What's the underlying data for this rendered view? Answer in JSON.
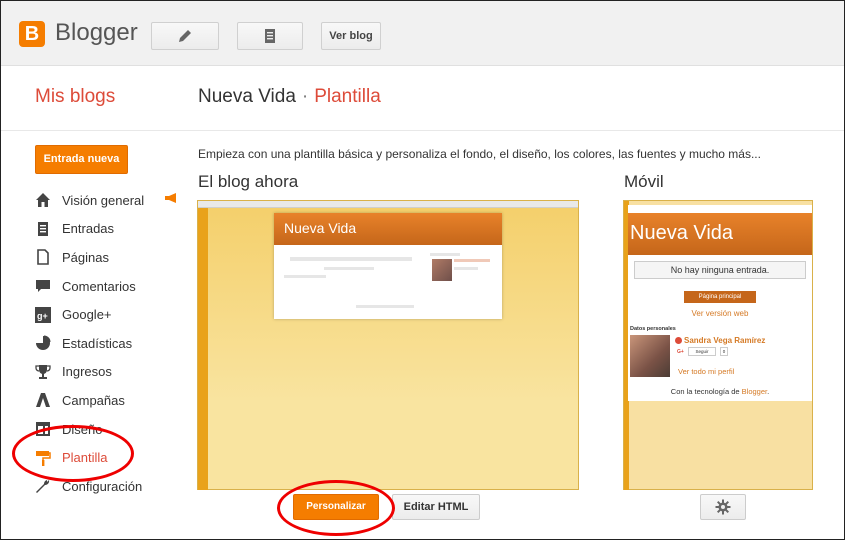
{
  "app": {
    "logo_letter": "B",
    "logo_text": "Blogger",
    "view_blog_label": "Ver blog"
  },
  "header": {
    "my_blogs": "Mis blogs",
    "blog_name": "Nueva Vida",
    "separator": "·",
    "current_page": "Plantilla"
  },
  "sidebar": {
    "new_post_label": "Entrada nueva",
    "items": [
      {
        "label": "Visión general",
        "icon": "home-icon"
      },
      {
        "label": "Entradas",
        "icon": "posts-icon"
      },
      {
        "label": "Páginas",
        "icon": "pages-icon"
      },
      {
        "label": "Comentarios",
        "icon": "comments-icon"
      },
      {
        "label": "Google+",
        "icon": "google-plus-icon"
      },
      {
        "label": "Estadísticas",
        "icon": "stats-icon"
      },
      {
        "label": "Ingresos",
        "icon": "trophy-icon"
      },
      {
        "label": "Campañas",
        "icon": "campaigns-icon"
      },
      {
        "label": "Diseño",
        "icon": "layout-icon"
      },
      {
        "label": "Plantilla",
        "icon": "paint-roller-icon",
        "active": true
      },
      {
        "label": "Configuración",
        "icon": "wrench-icon"
      }
    ]
  },
  "main": {
    "intro": "Empieza con una plantilla básica y personaliza el fondo, el diseño, los colores, las fuentes y mucho más...",
    "current_label": "El blog ahora",
    "mobile_label": "Móvil",
    "desktop_preview": {
      "title": "Nueva Vida"
    },
    "mobile_preview": {
      "title": "Nueva Vida",
      "no_posts": "No hay ninguna entrada.",
      "home_page": "Página principal",
      "web_version": "Ver versión web",
      "personal_data": "Datos personales",
      "author": "Sandra Vega Ramírez",
      "gplus": "G+",
      "follow": "Seguir",
      "follow_count": "0",
      "view_profile": "Ver todo mi perfil",
      "powered_prefix": "Con la tecnología de ",
      "powered_brand": "Blogger",
      "powered_suffix": "."
    },
    "customize_label": "Personalizar",
    "edit_html_label": "Editar HTML"
  },
  "colors": {
    "accent": "#f57d00",
    "link_red": "#dd4b39",
    "annotation": "#ee0000"
  }
}
